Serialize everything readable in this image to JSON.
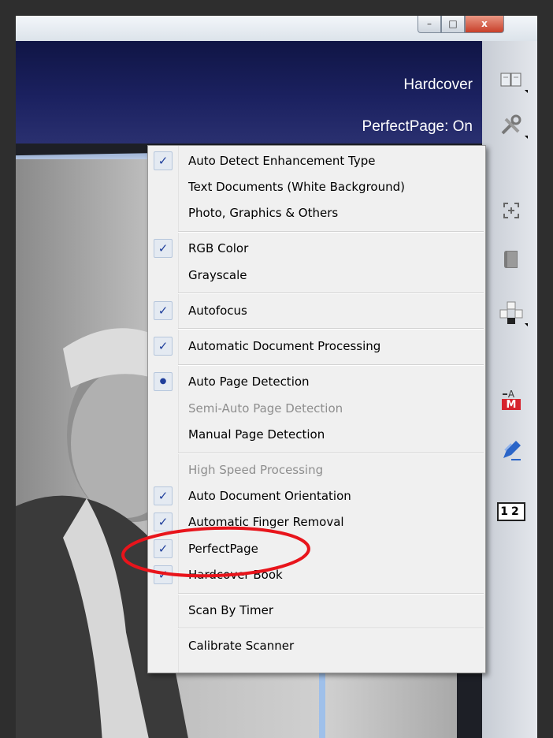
{
  "window": {
    "controls": {
      "minimize": "–",
      "maximize": "□",
      "close": "x"
    }
  },
  "viewer": {
    "status_mode": "Hardcover",
    "status_perfectpage": "PerfectPage: On"
  },
  "toolbar": {
    "tools": [
      {
        "icon": "book-view-icon"
      },
      {
        "icon": "tools-settings-icon"
      },
      {
        "icon": "crop-frame-icon"
      },
      {
        "icon": "book-cover-icon"
      },
      {
        "icon": "page-layout-icon"
      },
      {
        "icon": "text-ocr-icon",
        "label": "M"
      },
      {
        "icon": "scan-pen-icon"
      },
      {
        "icon": "page-number-icon",
        "label": "12"
      }
    ]
  },
  "menu": {
    "items": [
      {
        "label": "Auto Detect Enhancement Type",
        "mark": "check",
        "enabled": true
      },
      {
        "label": "Text Documents (White Background)",
        "mark": "none",
        "enabled": true
      },
      {
        "label": "Photo, Graphics & Others",
        "mark": "none",
        "enabled": true
      },
      {
        "label": "RGB Color",
        "mark": "check",
        "enabled": true
      },
      {
        "label": "Grayscale",
        "mark": "none",
        "enabled": true
      },
      {
        "label": "Autofocus",
        "mark": "check",
        "enabled": true
      },
      {
        "label": "Automatic Document Processing",
        "mark": "check",
        "enabled": true
      },
      {
        "label": "Auto Page Detection",
        "mark": "radio",
        "enabled": true
      },
      {
        "label": "Semi-Auto Page Detection",
        "mark": "none",
        "enabled": false
      },
      {
        "label": "Manual Page Detection",
        "mark": "none",
        "enabled": true
      },
      {
        "label": "High Speed Processing",
        "mark": "none",
        "enabled": false
      },
      {
        "label": "Auto Document Orientation",
        "mark": "check",
        "enabled": true
      },
      {
        "label": "Automatic Finger Removal",
        "mark": "check",
        "enabled": true
      },
      {
        "label": "PerfectPage",
        "mark": "check",
        "enabled": true
      },
      {
        "label": "Hardcover Book",
        "mark": "check",
        "enabled": true
      },
      {
        "label": "Scan By Timer",
        "mark": "none",
        "enabled": true
      },
      {
        "label": "Calibrate Scanner",
        "mark": "none",
        "enabled": true
      }
    ],
    "check_glyph": "✓",
    "radio_glyph": "●"
  },
  "colors": {
    "accent_check": "#1f3e9b",
    "annotation": "#e8141b",
    "header_band": "#1b2160"
  }
}
